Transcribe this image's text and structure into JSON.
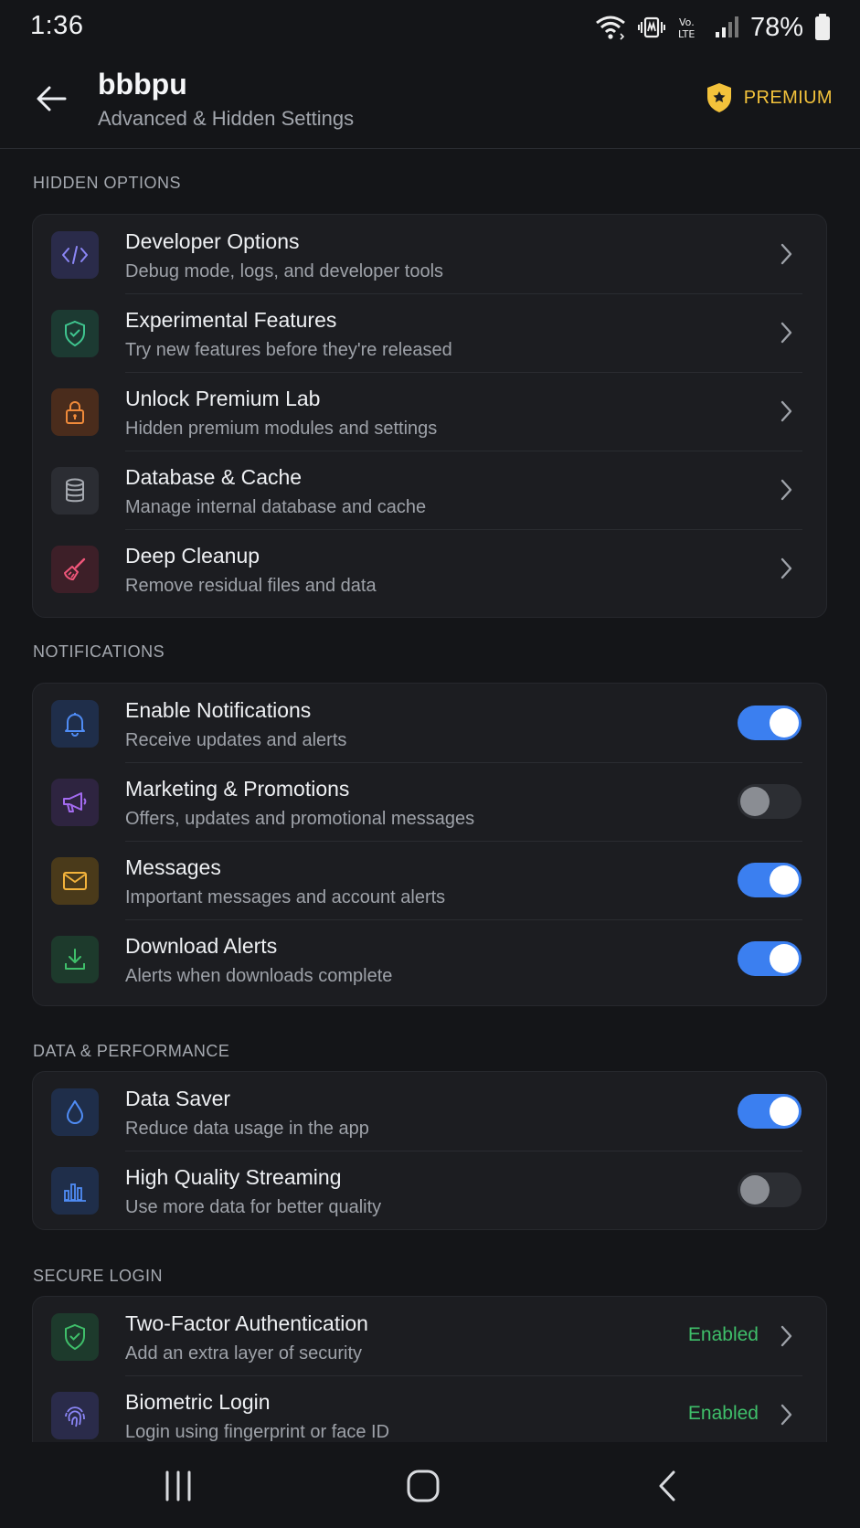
{
  "status_bar": {
    "time": "1:36",
    "battery_percent": "78%",
    "icons": [
      "wifi-icon",
      "vibrate-icon",
      "volte-icon",
      "signal-icon",
      "battery-icon"
    ]
  },
  "header": {
    "title": "bbbpu",
    "subtitle": "Advanced & Hidden Settings",
    "premium_label": "PREMIUM"
  },
  "colors": {
    "accent_blue": "#3b7ff0",
    "premium_gold": "#f3c23b",
    "enabled_green": "#3fbf6a",
    "background": "#141518",
    "card": "#1c1d21"
  },
  "sections": {
    "hidden": {
      "label": "HIDDEN OPTIONS",
      "items": [
        {
          "title": "Developer Options",
          "subtitle": "Debug mode, logs, and developer tools",
          "icon": "code-icon"
        },
        {
          "title": "Experimental Features",
          "subtitle": "Try new features before they're released",
          "icon": "shield-check-icon"
        },
        {
          "title": "Unlock Premium Lab",
          "subtitle": "Hidden premium modules and settings",
          "icon": "lock-icon"
        },
        {
          "title": "Database & Cache",
          "subtitle": "Manage internal database and cache",
          "icon": "database-icon"
        },
        {
          "title": "Deep Cleanup",
          "subtitle": "Remove residual files and data",
          "icon": "broom-icon"
        }
      ]
    },
    "notifications": {
      "label": "NOTIFICATIONS",
      "items": [
        {
          "title": "Enable Notifications",
          "subtitle": "Receive updates and alerts",
          "icon": "bell-icon",
          "enabled": true
        },
        {
          "title": "Marketing & Promotions",
          "subtitle": "Offers, updates and promotional messages",
          "icon": "megaphone-icon",
          "enabled": false
        },
        {
          "title": "Messages",
          "subtitle": "Important messages and account alerts",
          "icon": "mail-icon",
          "enabled": true
        },
        {
          "title": "Download Alerts",
          "subtitle": "Alerts when downloads complete",
          "icon": "download-icon",
          "enabled": true
        }
      ]
    },
    "data": {
      "label": "DATA & PERFORMANCE",
      "items": [
        {
          "title": "Data Saver",
          "subtitle": "Reduce data usage in the app",
          "icon": "droplet-icon",
          "enabled": true
        },
        {
          "title": "High Quality Streaming",
          "subtitle": "Use more data for better quality",
          "icon": "bar-chart-icon",
          "enabled": false
        }
      ]
    },
    "secure": {
      "label": "SECURE LOGIN",
      "items": [
        {
          "title": "Two-Factor Authentication",
          "subtitle": "Add an extra layer of security",
          "icon": "shield-check-icon",
          "status": "Enabled"
        },
        {
          "title": "Biometric Login",
          "subtitle": "Login using fingerprint or face ID",
          "icon": "fingerprint-icon",
          "status": "Enabled"
        }
      ]
    }
  },
  "nav_bar": {
    "icons": [
      "recents-icon",
      "home-icon",
      "back-nav-icon"
    ]
  }
}
